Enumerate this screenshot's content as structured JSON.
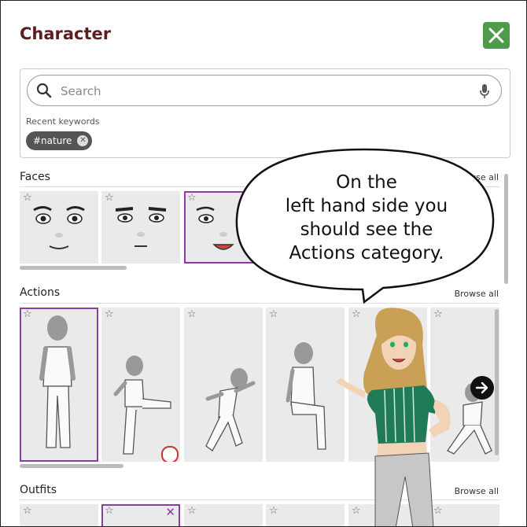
{
  "dialog": {
    "title": "Character"
  },
  "search": {
    "placeholder": "Search"
  },
  "recent": {
    "label": "Recent keywords",
    "chips": [
      "#nature"
    ]
  },
  "sections": {
    "faces": {
      "title": "Faces",
      "browse": "Browse all"
    },
    "actions": {
      "title": "Actions",
      "browse": "Browse all"
    },
    "outfits": {
      "title": "Outfits",
      "browse": "Browse all"
    }
  },
  "bubble": {
    "lines": [
      "On the",
      "left hand side you",
      "should see the",
      "Actions category."
    ]
  },
  "colors": {
    "title": "#5b1f1f",
    "accent": "#8b3aa8",
    "close": "#4f9b4b"
  }
}
